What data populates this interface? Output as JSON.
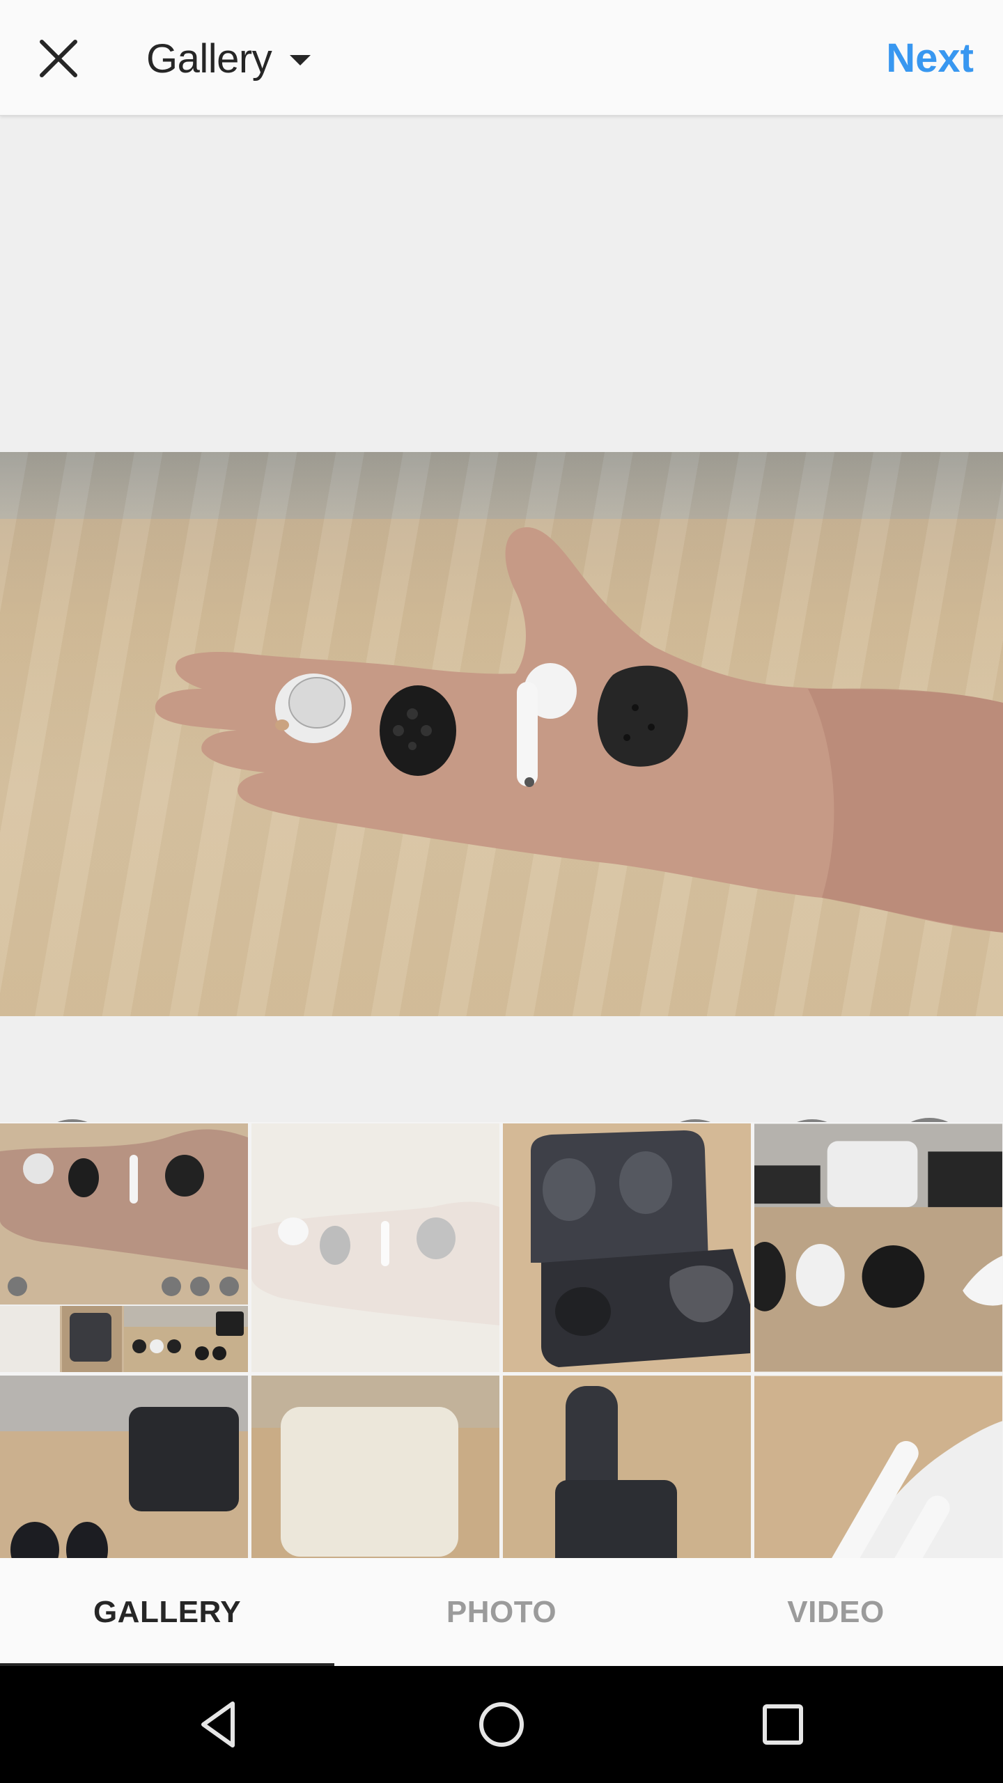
{
  "header": {
    "close_icon": "close-icon",
    "title": "Gallery",
    "dropdown_icon": "caret-down-icon",
    "next_label": "Next",
    "accent_color": "#3897f0"
  },
  "preview": {
    "description": "Hand holding four wireless earbuds over a wooden table",
    "tools": {
      "expand_icon": "expand-icon",
      "boomerang_icon": "infinity-icon",
      "layout_icon": "layout-icon",
      "multi_select_icon": "multi-select-icon"
    }
  },
  "gallery": {
    "thumbnails": [
      {
        "description": "Screenshot of gallery screen with earbuds in hand",
        "selected": false
      },
      {
        "description": "Faded photo of earbuds in hand",
        "selected": true
      },
      {
        "description": "Dark earbud charging case open on wooden table"
      },
      {
        "description": "Close-up of black and white earbuds on table"
      },
      {
        "description": "Black earbuds with dark case"
      },
      {
        "description": "White earbud case with white earbuds"
      },
      {
        "description": "Tall dark charging case with ear tips"
      },
      {
        "description": "White AirPods on case"
      }
    ]
  },
  "tabs": [
    {
      "label": "GALLERY",
      "active": true
    },
    {
      "label": "PHOTO",
      "active": false
    },
    {
      "label": "VIDEO",
      "active": false
    }
  ],
  "system_nav": {
    "back_icon": "back-triangle-icon",
    "home_icon": "home-circle-icon",
    "recents_icon": "recents-square-icon"
  }
}
